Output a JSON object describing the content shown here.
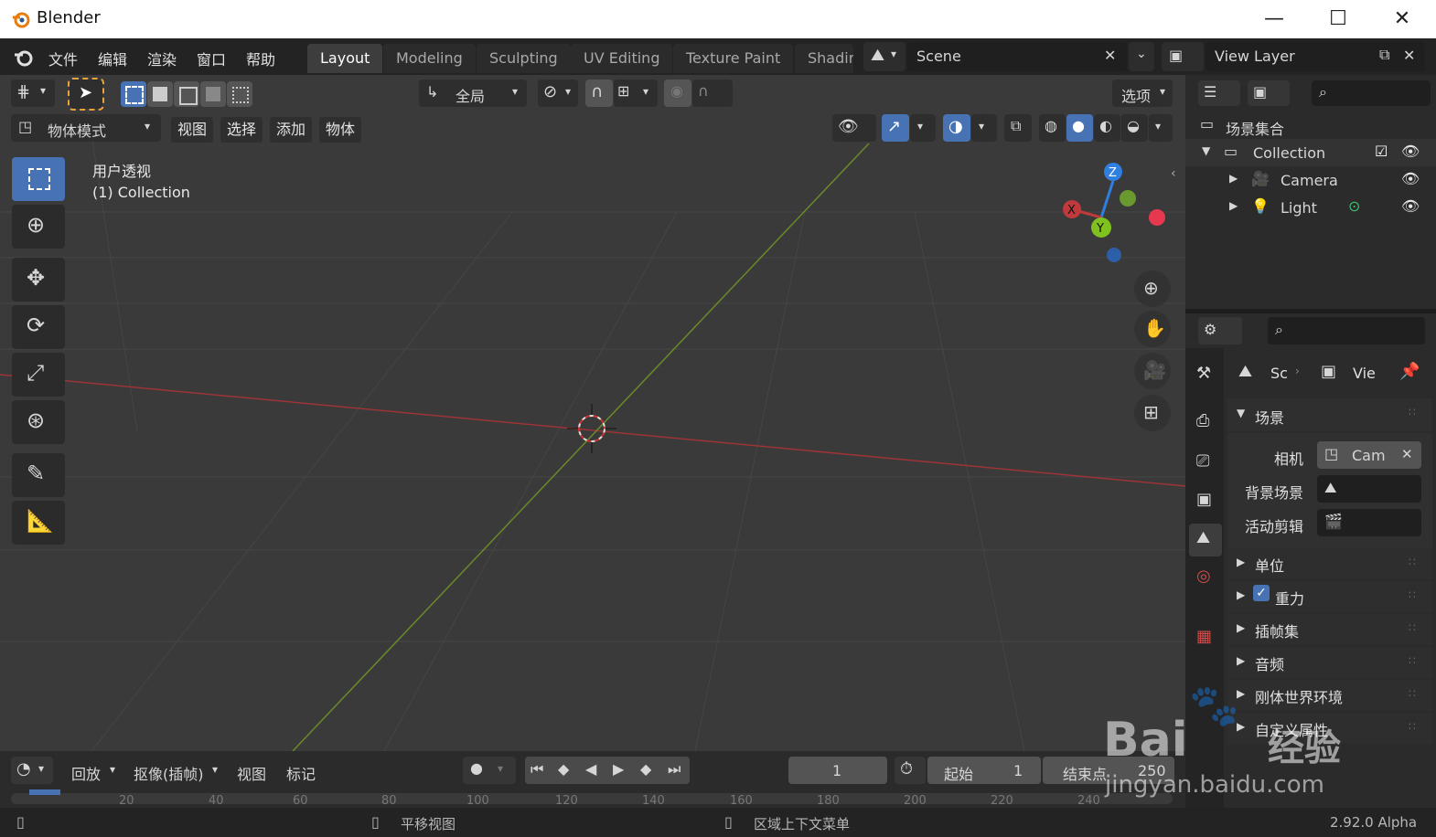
{
  "window": {
    "title": "Blender",
    "minimize": "—",
    "maximize": "☐",
    "close": "✕"
  },
  "topbar": {
    "menus": [
      "文件",
      "编辑",
      "渲染",
      "窗口",
      "帮助"
    ],
    "workspaces": [
      "Layout",
      "Modeling",
      "Sculpting",
      "UV Editing",
      "Texture Paint",
      "Shadir"
    ],
    "active_workspace": "Layout",
    "scene": "Scene",
    "view_layer": "View Layer"
  },
  "viewport_header": {
    "transform_orientation": "全局",
    "options_label": "选项",
    "mode": "物体模式",
    "menus": [
      "视图",
      "选择",
      "添加",
      "物体"
    ]
  },
  "viewport": {
    "view_name": "用户透视",
    "collection_label": "(1) Collection",
    "gizmo": {
      "x": "X",
      "y": "Y",
      "z": "Z"
    }
  },
  "outliner": {
    "root": "场景集合",
    "collection": "Collection",
    "items": [
      "Camera",
      "Light"
    ]
  },
  "properties": {
    "breadcrumb_scene": "Sc",
    "breadcrumb_view": "Vie",
    "scene_panel": "场景",
    "camera_label": "相机",
    "camera_value": "Cam",
    "background_label": "背景场景",
    "clip_label": "活动剪辑",
    "panels": [
      "单位",
      "重力",
      "插帧集",
      "音频",
      "刚体世界环境",
      "自定义属性"
    ]
  },
  "timeline": {
    "menus": [
      "回放",
      "抠像(插帧)",
      "视图",
      "标记"
    ],
    "current_frame": "1",
    "start_label": "起始",
    "start_value": "1",
    "end_label": "结束点",
    "end_value": "250",
    "ruler": [
      "20",
      "40",
      "60",
      "80",
      "100",
      "120",
      "140",
      "160",
      "180",
      "200",
      "220",
      "240"
    ]
  },
  "statusbar": {
    "pan": "平移视图",
    "context_menu": "区域上下文菜单",
    "version": "2.92.0 Alpha"
  },
  "watermark": {
    "brand": "Bai",
    "brand2": "经验",
    "url": "jingyan.baidu.com"
  },
  "colors": {
    "accent": "#4772b3",
    "x_axis": "#c0393c",
    "y_axis": "#6a9a2f",
    "z_axis": "#2f7fe0"
  }
}
